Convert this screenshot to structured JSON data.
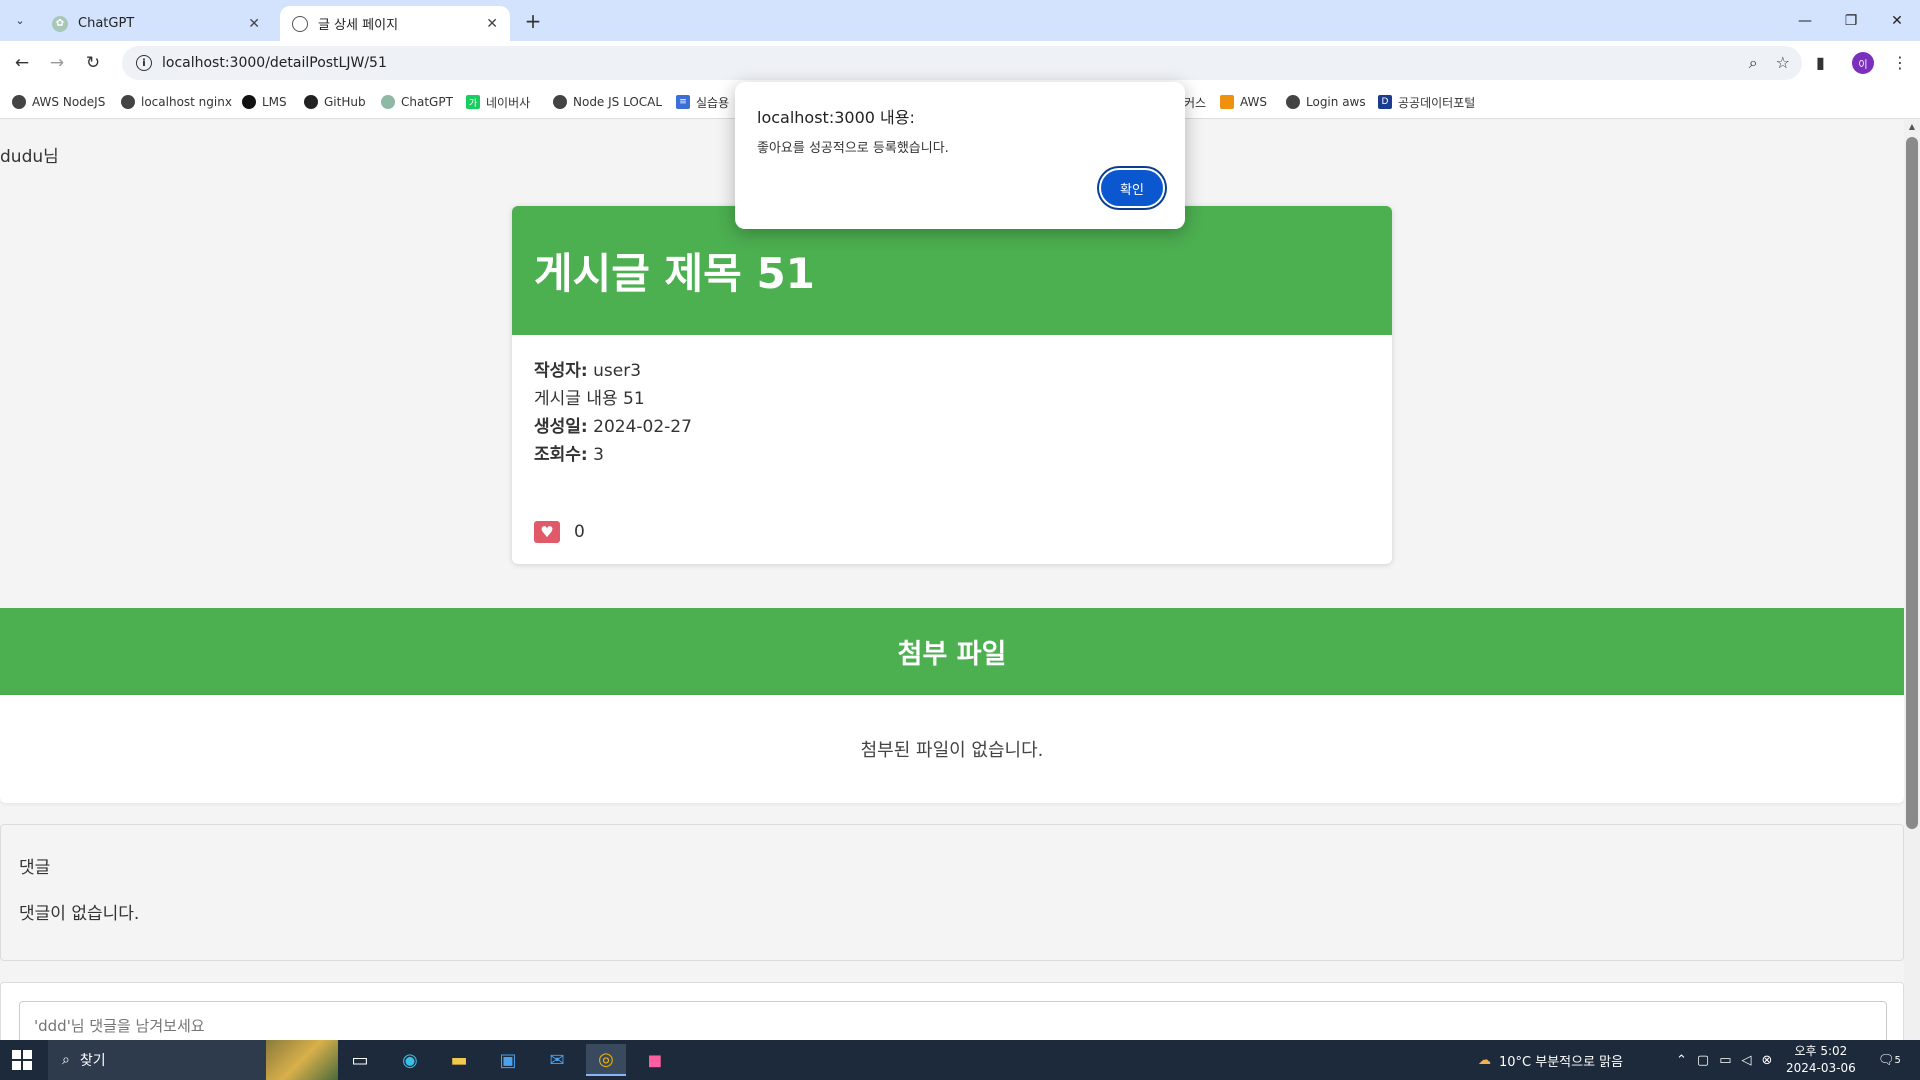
{
  "browser": {
    "tabs": [
      {
        "title": "ChatGPT",
        "icon": "chatgpt-icon",
        "active": false
      },
      {
        "title": "글 상세 페이지",
        "icon": "globe-icon",
        "active": true
      }
    ],
    "url": "localhost:3000/detailPostLJW/51",
    "bookmarks": [
      {
        "label": "AWS NodeJS",
        "icon": "globe-icon"
      },
      {
        "label": "localhost nginx",
        "icon": "globe-icon"
      },
      {
        "label": "LMS",
        "icon": "lms-icon"
      },
      {
        "label": "GitHub",
        "icon": "github-icon"
      },
      {
        "label": "ChatGPT",
        "icon": "chatgpt-icon"
      },
      {
        "label": "네이버사",
        "icon": "naver-icon"
      },
      {
        "label": "Node JS LOCAL",
        "icon": "globe-icon"
      },
      {
        "label": "실습용",
        "icon": "doc-icon"
      },
      {
        "label": "커스",
        "icon": ""
      },
      {
        "label": "AWS",
        "icon": "aws-icon"
      },
      {
        "label": "Login aws",
        "icon": "globe-icon"
      },
      {
        "label": "공공데이터포털",
        "icon": "data-portal-icon"
      }
    ],
    "profile_initial": "이"
  },
  "page": {
    "greeting": "dudu님",
    "post": {
      "title": "게시글 제목 51",
      "author_label": "작성자:",
      "author": "user3",
      "content": "게시글 내용 51",
      "created_label": "생성일:",
      "created": "2024-02-27",
      "views_label": "조회수:",
      "views": "3",
      "likes": "0"
    },
    "attachments": {
      "title": "첨부 파일",
      "empty": "첨부된 파일이 없습니다."
    },
    "comments": {
      "title": "댓글",
      "empty": "댓글이 없습니다."
    },
    "comment_form": {
      "placeholder": "'ddd'님 댓글을 남겨보세요"
    }
  },
  "dialog": {
    "title": "localhost:3000 내용:",
    "message": "좋아요를 성공적으로 등록했습니다.",
    "ok_label": "확인"
  },
  "taskbar": {
    "search_label": "찾기",
    "weather": "10°C  부분적으로 맑음",
    "time": "오후 5:02",
    "date": "2024-03-06",
    "notifications": "5"
  },
  "colors": {
    "accent_green": "#4caf50",
    "dialog_button": "#0b57d0",
    "like_heart": "#e05a6a"
  }
}
